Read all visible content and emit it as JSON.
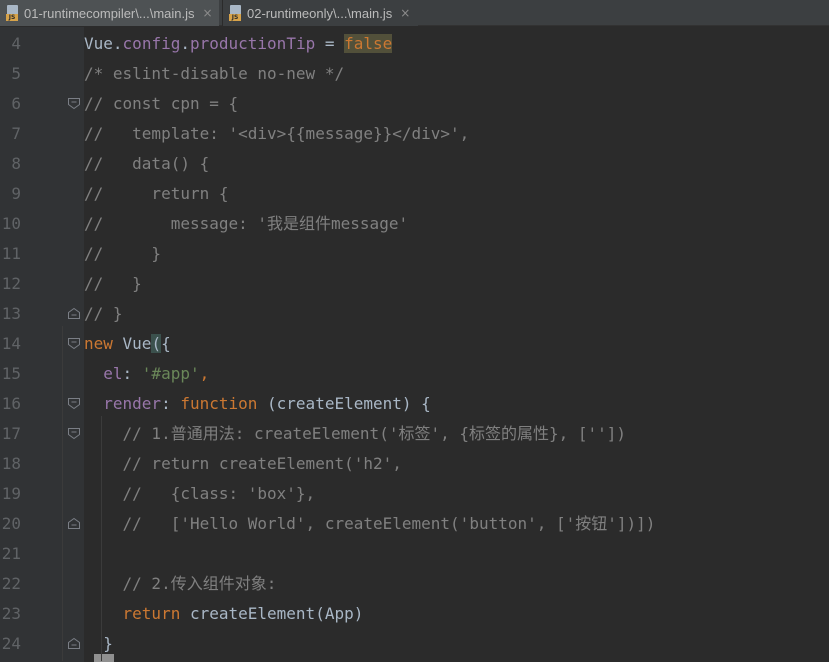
{
  "tabs": [
    {
      "title": "01-runtimecompiler\\...\\main.js",
      "icon": "js-file-icon",
      "active": true
    },
    {
      "title": "02-runtimeonly\\...\\main.js",
      "icon": "js-file-icon",
      "active": false
    }
  ],
  "close_glyph": "×",
  "colors": {
    "keyword": "#cc7832",
    "string": "#6a8759",
    "comment": "#808080",
    "property": "#9876aa",
    "plain": "#a9b7c6"
  },
  "lines": [
    {
      "n": "4",
      "fold": "",
      "tokens": [
        {
          "t": "Vue",
          "c": "plain"
        },
        {
          "t": ".",
          "c": "plain"
        },
        {
          "t": "config",
          "c": "prop"
        },
        {
          "t": ".",
          "c": "plain"
        },
        {
          "t": "productionTip",
          "c": "prop"
        },
        {
          "t": " = ",
          "c": "plain"
        },
        {
          "t": "false",
          "c": "kw"
        }
      ]
    },
    {
      "n": "5",
      "fold": "",
      "tokens": [
        {
          "t": "/* eslint-disable no-new */",
          "c": "cm"
        }
      ]
    },
    {
      "n": "6",
      "fold": "open",
      "tokens": [
        {
          "t": "// const cpn = {",
          "c": "cm"
        }
      ]
    },
    {
      "n": "7",
      "fold": "",
      "tokens": [
        {
          "t": "//   template: '<div>{{message}}</div>',",
          "c": "cm"
        }
      ]
    },
    {
      "n": "8",
      "fold": "",
      "tokens": [
        {
          "t": "//   data() {",
          "c": "cm"
        }
      ]
    },
    {
      "n": "9",
      "fold": "",
      "tokens": [
        {
          "t": "//     return {",
          "c": "cm"
        }
      ]
    },
    {
      "n": "10",
      "fold": "",
      "tokens": [
        {
          "t": "//       message: '我是组件message'",
          "c": "cm"
        }
      ]
    },
    {
      "n": "11",
      "fold": "",
      "tokens": [
        {
          "t": "//     }",
          "c": "cm"
        }
      ]
    },
    {
      "n": "12",
      "fold": "",
      "tokens": [
        {
          "t": "//   }",
          "c": "cm"
        }
      ]
    },
    {
      "n": "13",
      "fold": "close",
      "tokens": [
        {
          "t": "// }",
          "c": "cm"
        }
      ]
    },
    {
      "n": "14",
      "fold": "open",
      "tokens": [
        {
          "t": "new",
          "c": "kw"
        },
        {
          "t": " Vue",
          "c": "plain"
        },
        {
          "t": "(",
          "c": "plain",
          "hl": true
        },
        {
          "t": "{",
          "c": "plain"
        }
      ]
    },
    {
      "n": "15",
      "fold": "",
      "tokens": [
        {
          "t": "  ",
          "c": "plain"
        },
        {
          "t": "el",
          "c": "prop"
        },
        {
          "t": ": ",
          "c": "plain"
        },
        {
          "t": "'#app'",
          "c": "str"
        },
        {
          "t": ",",
          "c": "kw"
        }
      ]
    },
    {
      "n": "16",
      "fold": "open",
      "tokens": [
        {
          "t": "  ",
          "c": "plain"
        },
        {
          "t": "render",
          "c": "prop"
        },
        {
          "t": ": ",
          "c": "plain"
        },
        {
          "t": "function",
          "c": "kw"
        },
        {
          "t": " (createElement) {",
          "c": "plain"
        }
      ]
    },
    {
      "n": "17",
      "fold": "open",
      "tokens": [
        {
          "t": "    // 1.普通用法: createElement('标签', {标签的属性}, [''])",
          "c": "cm"
        }
      ]
    },
    {
      "n": "18",
      "fold": "",
      "tokens": [
        {
          "t": "    // return createElement('h2',",
          "c": "cm"
        }
      ]
    },
    {
      "n": "19",
      "fold": "",
      "tokens": [
        {
          "t": "    //   {class: 'box'},",
          "c": "cm"
        }
      ]
    },
    {
      "n": "20",
      "fold": "close",
      "tokens": [
        {
          "t": "    //   ['Hello World', createElement('button', ['按钮'])])",
          "c": "cm"
        }
      ]
    },
    {
      "n": "21",
      "fold": "",
      "tokens": [
        {
          "t": "",
          "c": "plain"
        }
      ]
    },
    {
      "n": "22",
      "fold": "",
      "tokens": [
        {
          "t": "    // 2.传入组件对象:",
          "c": "cm"
        }
      ]
    },
    {
      "n": "23",
      "fold": "",
      "tokens": [
        {
          "t": "    ",
          "c": "plain"
        },
        {
          "t": "return",
          "c": "kw"
        },
        {
          "t": " createElement(App)",
          "c": "plain"
        }
      ]
    },
    {
      "n": "24",
      "fold": "close",
      "tokens": [
        {
          "t": "  }",
          "c": "plain"
        }
      ]
    }
  ]
}
